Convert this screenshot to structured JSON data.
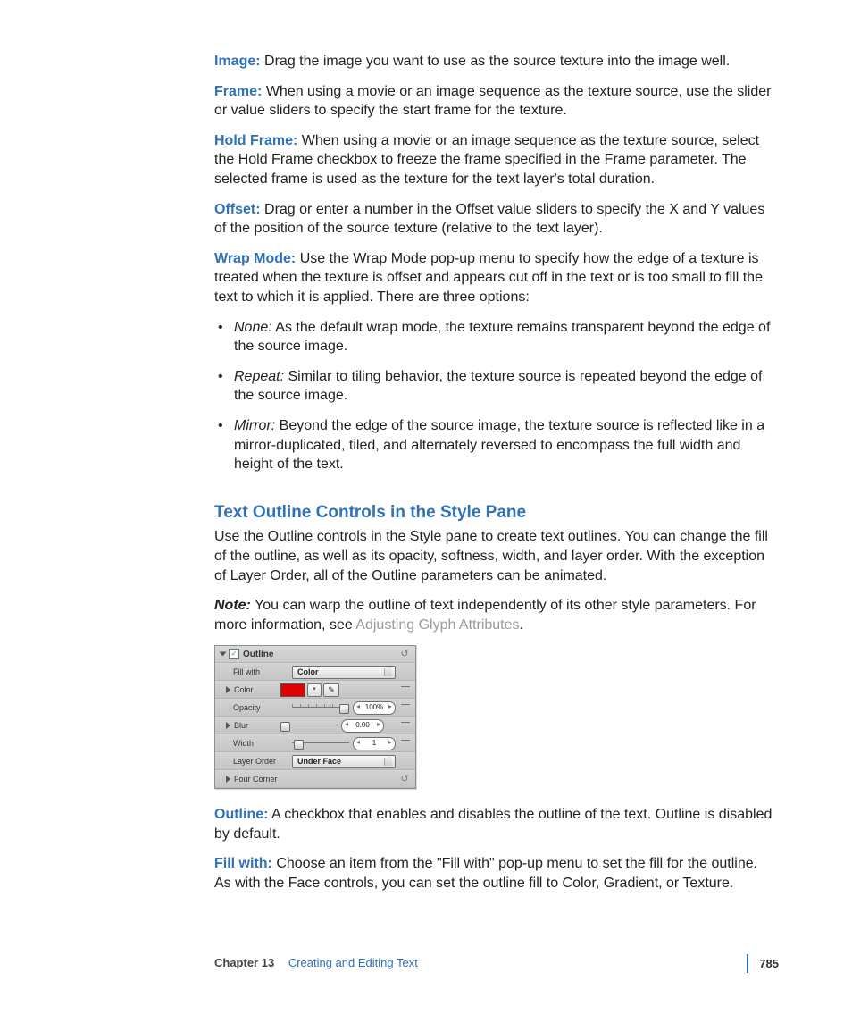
{
  "defs": {
    "image": {
      "label": "Image:",
      "text": "Drag the image you want to use as the source texture into the image well."
    },
    "frame": {
      "label": "Frame:",
      "text": "When using a movie or an image sequence as the texture source, use the slider or value sliders to specify the start frame for the texture."
    },
    "hold": {
      "label": "Hold Frame:",
      "text": "When using a movie or an image sequence as the texture source, select the Hold Frame checkbox to freeze the frame specified in the Frame parameter. The selected frame is used as the texture for the text layer's total duration."
    },
    "offset": {
      "label": "Offset:",
      "text": "Drag or enter a number in the Offset value sliders to specify the X and Y values of the position of the source texture (relative to the text layer)."
    },
    "wrap": {
      "label": "Wrap Mode:",
      "text": "Use the Wrap Mode pop-up menu to specify how the edge of a texture is treated when the texture is offset and appears cut off in the text or is too small to fill the text to which it is applied. There are three options:"
    }
  },
  "wrap_options": [
    {
      "name": "None:",
      "text": "As the default wrap mode, the texture remains transparent beyond the edge of the source image."
    },
    {
      "name": "Repeat:",
      "text": "Similar to tiling behavior, the texture source is repeated beyond the edge of the source image."
    },
    {
      "name": "Mirror:",
      "text": "Beyond the edge of the source image, the texture source is reflected like in a mirror-duplicated, tiled, and alternately reversed to encompass the full width and height of the text."
    }
  ],
  "section": {
    "heading": "Text Outline Controls in the Style Pane",
    "intro": "Use the Outline controls in the Style pane to create text outlines. You can change the fill of the outline, as well as its opacity, softness, width, and layer order. With the exception of Layer Order, all of the Outline parameters can be animated.",
    "note_label": "Note:",
    "note_text": "You can warp the outline of text independently of its other style parameters. For more information, see ",
    "note_link": "Adjusting Glyph Attributes",
    "note_tail": "."
  },
  "panel": {
    "title": "Outline",
    "rows": {
      "fillwith": {
        "label": "Fill with",
        "value": "Color"
      },
      "color": {
        "label": "Color"
      },
      "opacity": {
        "label": "Opacity",
        "value": "100%"
      },
      "blur": {
        "label": "Blur",
        "value": "0.00"
      },
      "width": {
        "label": "Width",
        "value": "1"
      },
      "layer": {
        "label": "Layer Order",
        "value": "Under Face"
      },
      "four": {
        "label": "Four Corner"
      }
    }
  },
  "defs2": {
    "outline": {
      "label": "Outline:",
      "text": "A checkbox that enables and disables the outline of the text. Outline is disabled by default."
    },
    "fillwith": {
      "label": "Fill with:",
      "text": "Choose an item from the \"Fill with\" pop-up menu to set the fill for the outline. As with the Face controls, you can set the outline fill to Color, Gradient, or Texture."
    }
  },
  "footer": {
    "chapter_num": "Chapter 13",
    "chapter_title": "Creating and Editing Text",
    "page": "785"
  }
}
